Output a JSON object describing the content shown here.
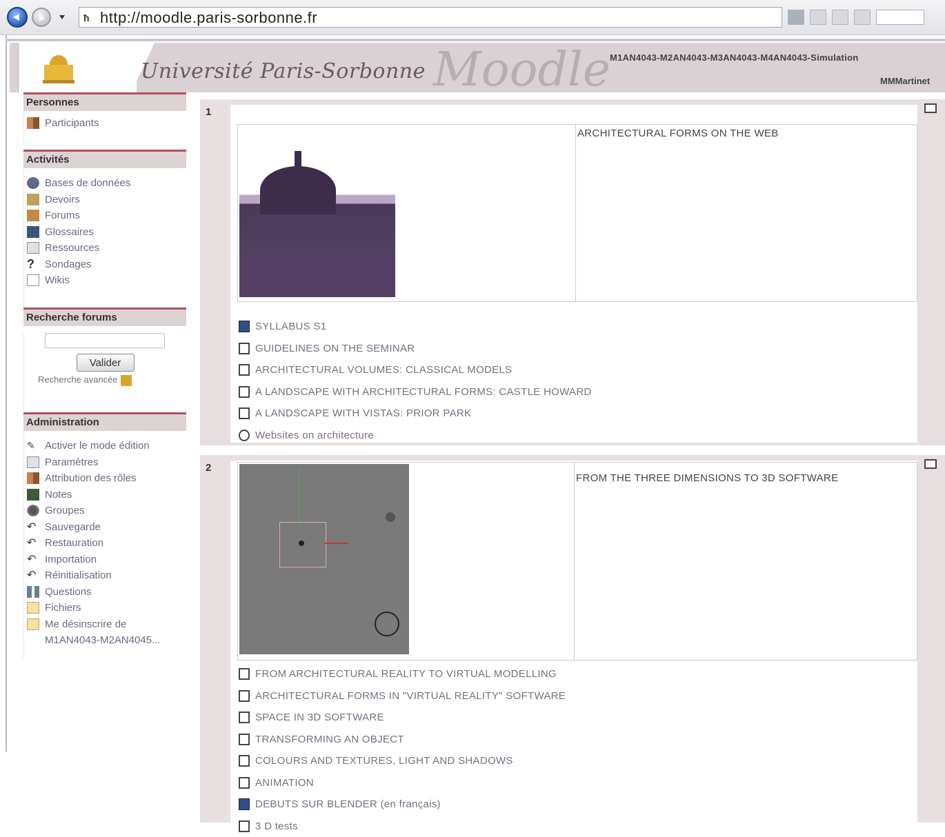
{
  "browser": {
    "url": "http://moodle.paris-sorbonne.fr"
  },
  "header": {
    "university": "Université Paris-Sorbonne",
    "brand": "Moodle",
    "course_code": "M1AN4043-M2AN4043-M3AN4043-M4AN4043-Simulation",
    "user": "MMMartinet"
  },
  "blocks": {
    "people": {
      "title": "Personnes",
      "items": [
        {
          "label": "Participants",
          "icon": "people-icon"
        }
      ]
    },
    "activities": {
      "title": "Activités",
      "items": [
        {
          "label": "Bases de données",
          "icon": "database-icon"
        },
        {
          "label": "Devoirs",
          "icon": "assignment-icon"
        },
        {
          "label": "Forums",
          "icon": "forum-icon"
        },
        {
          "label": "Glossaires",
          "icon": "glossary-icon"
        },
        {
          "label": "Ressources",
          "icon": "resource-icon"
        },
        {
          "label": "Sondages",
          "icon": "survey-icon"
        },
        {
          "label": "Wikis",
          "icon": "wiki-icon"
        }
      ]
    },
    "search": {
      "title": "Recherche forums",
      "input_value": "",
      "button": "Valider",
      "advanced": "Recherche avancée"
    },
    "admin": {
      "title": "Administration",
      "items": [
        {
          "label": "Activer le mode édition",
          "icon": "edit-icon"
        },
        {
          "label": "Paramètres",
          "icon": "settings-icon"
        },
        {
          "label": "Attribution des rôles",
          "icon": "roles-icon"
        },
        {
          "label": "Notes",
          "icon": "grades-icon"
        },
        {
          "label": "Groupes",
          "icon": "groups-icon"
        },
        {
          "label": "Sauvegarde",
          "icon": "backup-icon"
        },
        {
          "label": "Restauration",
          "icon": "restore-icon"
        },
        {
          "label": "Importation",
          "icon": "import-icon"
        },
        {
          "label": "Réinitialisation",
          "icon": "reset-icon"
        },
        {
          "label": "Questions",
          "icon": "questions-icon"
        },
        {
          "label": "Fichiers",
          "icon": "files-icon"
        },
        {
          "label": "Me désinscrire de",
          "icon": "unenrol-icon"
        },
        {
          "label": "M1AN4043-M2AN4045...",
          "icon": ""
        }
      ]
    }
  },
  "sections": [
    {
      "number": "1",
      "title": "ARCHITECTURAL FORMS ON THE WEB",
      "activities": [
        {
          "label": "SYLLABUS S1",
          "icon": "word-doc-icon"
        },
        {
          "label": "GUIDELINES ON THE SEMINAR",
          "icon": "document-icon"
        },
        {
          "label": "ARCHITECTURAL VOLUMES: CLASSICAL MODELS",
          "icon": "document-icon"
        },
        {
          "label": "A LANDSCAPE WITH ARCHITECTURAL FORMS: CASTLE HOWARD",
          "icon": "document-icon"
        },
        {
          "label": "A LANDSCAPE WITH VISTAS: PRIOR PARK",
          "icon": "document-icon"
        },
        {
          "label": "Websites on architecture",
          "icon": "link-icon"
        }
      ]
    },
    {
      "number": "2",
      "title": "FROM THE THREE DIMENSIONS TO 3D SOFTWARE",
      "activities": [
        {
          "label": "FROM ARCHITECTURAL REALITY TO VIRTUAL MODELLING",
          "icon": "document-icon"
        },
        {
          "label": "ARCHITECTURAL FORMS IN \"VIRTUAL REALITY\" SOFTWARE",
          "icon": "document-icon"
        },
        {
          "label": "SPACE IN 3D SOFTWARE",
          "icon": "document-icon"
        },
        {
          "label": "TRANSFORMING AN OBJECT",
          "icon": "document-icon"
        },
        {
          "label": "COLOURS AND TEXTURES, LIGHT AND SHADOWS",
          "icon": "document-icon"
        },
        {
          "label": "ANIMATION",
          "icon": "document-icon"
        },
        {
          "label": "DEBUTS SUR BLENDER (en français)",
          "icon": "word-doc-icon"
        },
        {
          "label": "3 D tests",
          "icon": "document-icon"
        }
      ]
    }
  ]
}
